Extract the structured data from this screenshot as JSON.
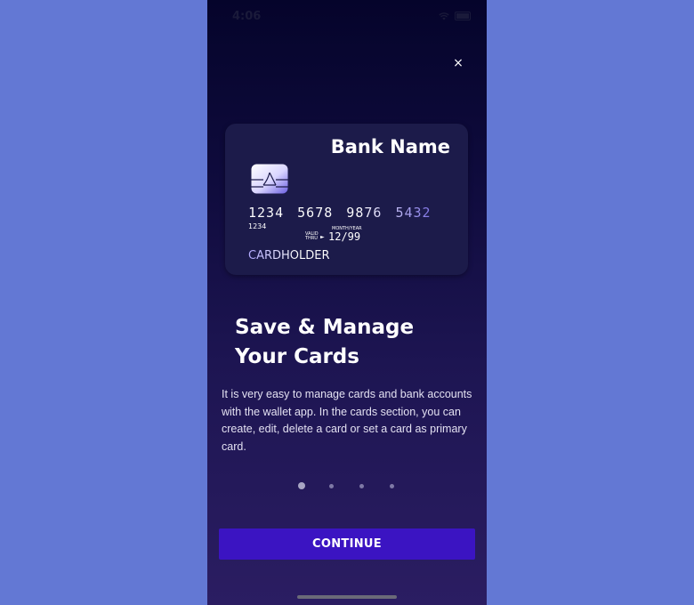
{
  "status_bar": {
    "time": "4:06",
    "icons": [
      "wifi-icon",
      "battery-icon"
    ]
  },
  "close": {
    "glyph": "×"
  },
  "card": {
    "bank_name": "Bank Name",
    "number": "1234 5678 9876 5432",
    "small_number": "1234",
    "valid_thru": "VALID THRU",
    "month_year": "MONTH/YEAR",
    "expiry": "12/99",
    "cardholder": "CARDHOLDER"
  },
  "onboarding": {
    "title": "Save & Manage Your Cards",
    "description": "It is very easy to manage cards and bank accounts with the wallet app. In the cards section, you can create, edit, delete a card or set a card as primary card.",
    "pages_total": 4,
    "current_page": 1
  },
  "actions": {
    "continue_label": "CONTINUE"
  },
  "colors": {
    "background": "#6378d4",
    "screen_top": "#05042b",
    "screen_bottom": "#2b1d62",
    "card": "#1c1b4a",
    "button": "#3b14c2",
    "chip_accent": "#7f74e6"
  }
}
